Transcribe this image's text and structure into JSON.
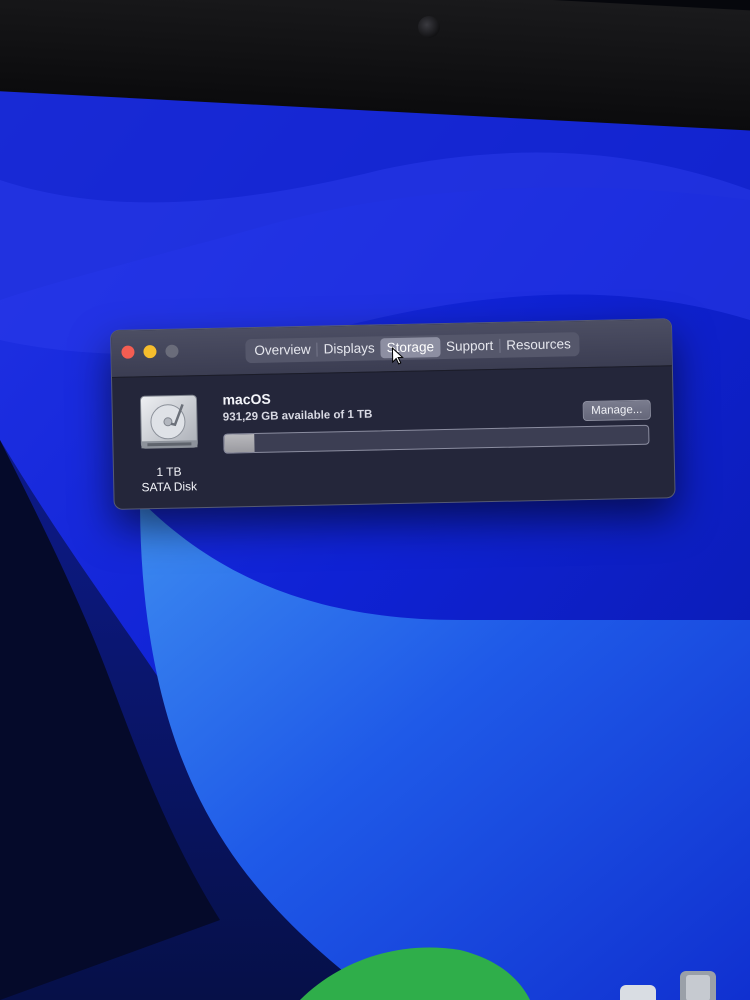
{
  "window": {
    "tabs": [
      {
        "label": "Overview"
      },
      {
        "label": "Displays"
      },
      {
        "label": "Storage"
      },
      {
        "label": "Support"
      },
      {
        "label": "Resources"
      }
    ],
    "active_tab": "Storage"
  },
  "disk": {
    "size_label": "1 TB",
    "type_label": "SATA Disk",
    "icon": "hard-drive-icon"
  },
  "volume": {
    "name": "macOS",
    "available_text": "931,29 GB available of 1 TB",
    "used_fraction": 0.07
  },
  "buttons": {
    "manage_label": "Manage..."
  },
  "colors": {
    "wallpaper_blue": "#1a2ad8",
    "close": "#f45d52",
    "minimize": "#f6bd2d",
    "zoom": "#6a6c7a"
  }
}
